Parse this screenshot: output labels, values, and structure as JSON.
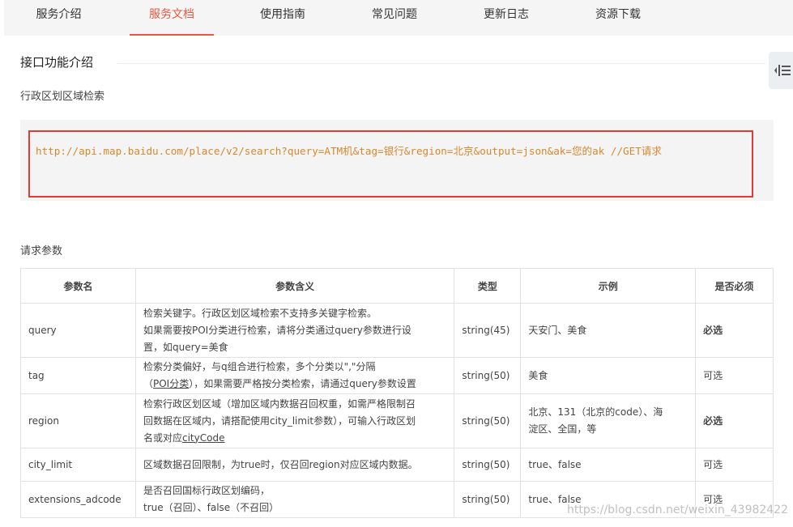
{
  "tabs": [
    "服务介绍",
    "服务文档",
    "使用指南",
    "常见问题",
    "更新日志",
    "资源下载"
  ],
  "active_tab_index": 1,
  "section_title": "接口功能介绍",
  "sub_title": "行政区划区域检索",
  "code_line": "http://api.map.baidu.com/place/v2/search?query=ATM机&tag=银行&region=北京&output=json&ak=您的ak //GET请求",
  "request_params_title": "请求参数",
  "table": {
    "headers": [
      "参数名",
      "参数含义",
      "类型",
      "示例",
      "是否必须"
    ],
    "rows": [
      {
        "name": "query",
        "meaning_lines": [
          "检索关键字。行政区划区域检索不支持多关键字检索。",
          "如果需要按POI分类进行检索，请将分类通过query参数进行设",
          "置，如query=美食"
        ],
        "type": "string(45)",
        "example_lines": [
          "天安门、美食"
        ],
        "required": "必选"
      },
      {
        "name": "tag",
        "meaning_line1": "检索分类偏好，与q组合进行检索，多个分类以\",\"分隔",
        "meaning_line2_pre": "（",
        "meaning_line2_link": "POI分类",
        "meaning_line2_post": "），如果需要严格按分类检索，请通过query参数设置",
        "type": "string(50)",
        "example_lines": [
          "美食"
        ],
        "required": "可选"
      },
      {
        "name": "region",
        "meaning_line1": "检索行政区划区域（增加区域内数据召回权重，如需严格限制召",
        "meaning_line2": "回数据在区域内，请搭配使用city_limit参数），可输入行政区划",
        "meaning_line3_pre": "名或对应",
        "meaning_line3_link": "cityCode",
        "type": "string(50)",
        "example_lines": [
          "北京、131（北京的code）、海",
          "淀区、全国，等"
        ],
        "required": "必选"
      },
      {
        "name": "city_limit",
        "meaning_lines": [
          "区域数据召回限制，为true时，仅召回region对应区域内数据。"
        ],
        "type": "string(50)",
        "example_lines": [
          "true、false"
        ],
        "required": "可选"
      },
      {
        "name": "extensions_adcode",
        "meaning_lines": [
          "是否召回国标行政区划编码，",
          "true（召回）、false（不召回）"
        ],
        "type": "string(50)",
        "example_lines": [
          "true、false"
        ],
        "required": "可选"
      }
    ]
  },
  "watermark": "https://blog.csdn.net/weixin_43982422"
}
